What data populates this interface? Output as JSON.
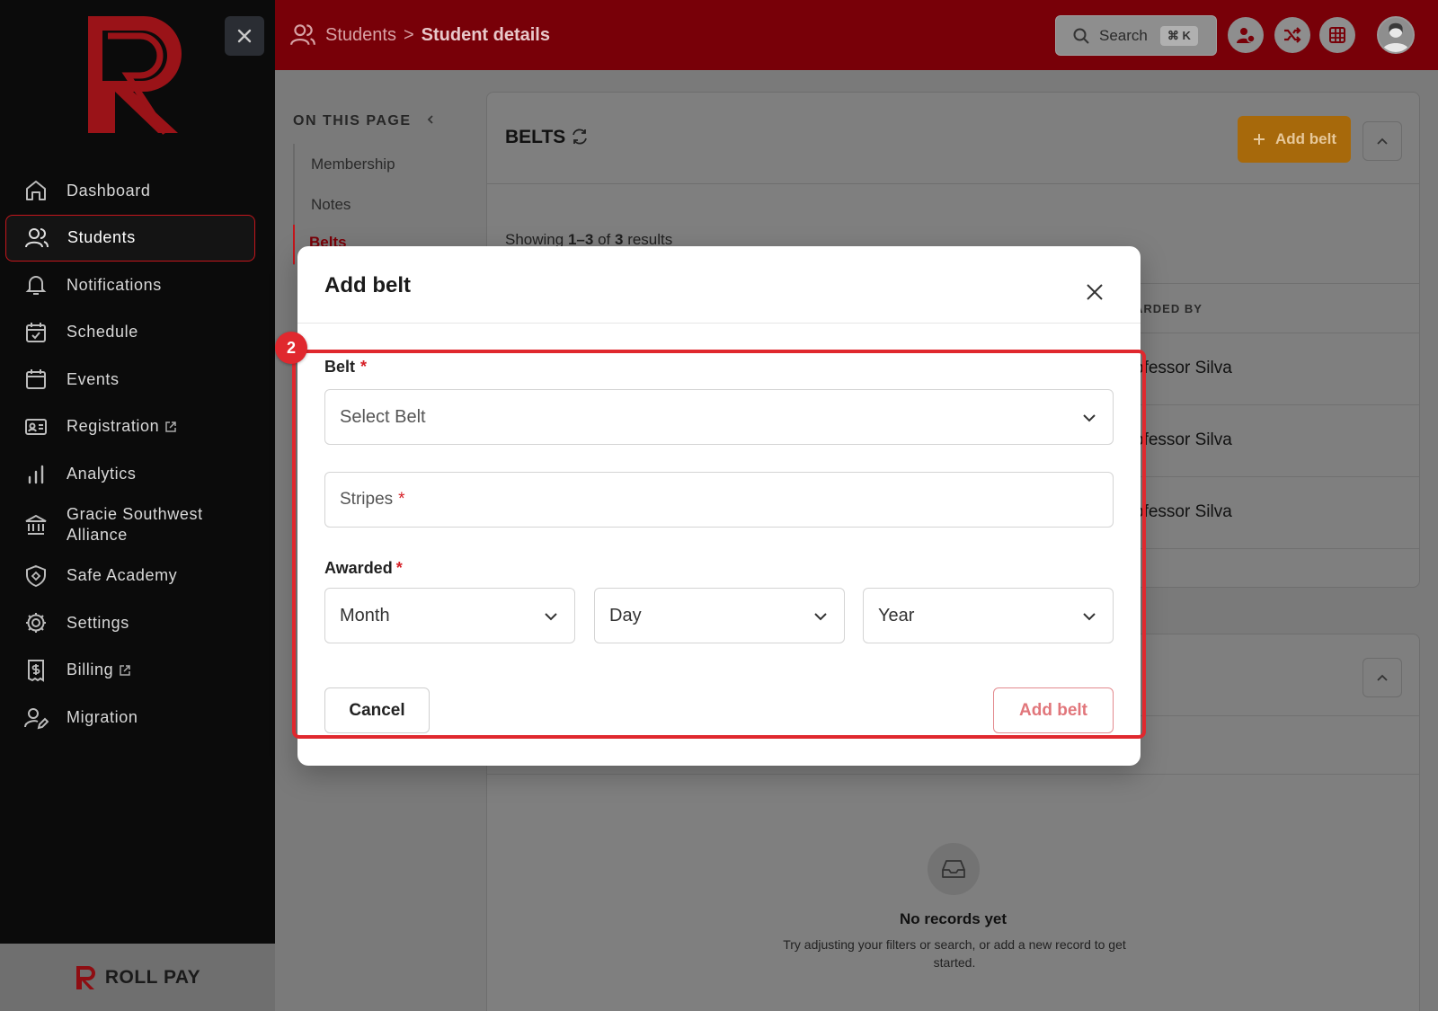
{
  "sidebar": {
    "close_label": "Close sidebar",
    "items": [
      {
        "label": "Dashboard",
        "icon": "home-icon"
      },
      {
        "label": "Students",
        "icon": "users-icon",
        "active": true
      },
      {
        "label": "Notifications",
        "icon": "bell-icon"
      },
      {
        "label": "Schedule",
        "icon": "calendar-check-icon"
      },
      {
        "label": "Events",
        "icon": "calendar-icon"
      },
      {
        "label": "Registration",
        "icon": "id-card-icon",
        "external": true
      },
      {
        "label": "Analytics",
        "icon": "bar-chart-icon"
      },
      {
        "label": "Gracie Southwest Alliance",
        "icon": "bank-icon"
      },
      {
        "label": "Safe Academy",
        "icon": "shield-icon"
      },
      {
        "label": "Settings",
        "icon": "gear-icon"
      },
      {
        "label": "Billing",
        "icon": "receipt-dollar-icon",
        "external": true
      },
      {
        "label": "Migration",
        "icon": "user-edit-icon"
      }
    ],
    "footer_brand": "ROLL PAY"
  },
  "header": {
    "breadcrumb_parent": "Students",
    "breadcrumb_separator": ">",
    "breadcrumb_current": "Student details",
    "search_label": "Search",
    "search_shortcut": "⌘ K"
  },
  "onpage": {
    "title": "ON THIS PAGE",
    "items": [
      "Membership",
      "Notes",
      "Belts"
    ]
  },
  "belts_card": {
    "title": "BELTS",
    "add_button": "Add belt",
    "showing_prefix": "Showing",
    "showing_range": "1–3",
    "showing_of": "of",
    "showing_total": "3",
    "showing_suffix": "results",
    "col_awarded_by": "ARDED BY",
    "rows": [
      "ofessor Silva",
      "ofessor Silva",
      "ofessor Silva"
    ]
  },
  "empty_state": {
    "title": "No records yet",
    "subtitle": "Try adjusting your filters or search, or add a new record to get started."
  },
  "modal": {
    "title": "Add belt",
    "belt_label": "Belt",
    "belt_placeholder": "Select Belt",
    "stripes_placeholder": "Stripes",
    "awarded_label": "Awarded",
    "month": "Month",
    "day": "Day",
    "year": "Year",
    "required_mark": "*",
    "cancel": "Cancel",
    "submit": "Add belt"
  },
  "annotation": {
    "badge": "2"
  },
  "colors": {
    "brand_red": "#c4161c",
    "header_bg": "#780008",
    "add_button_bg": "#a7690b",
    "highlight": "#e0282e"
  }
}
